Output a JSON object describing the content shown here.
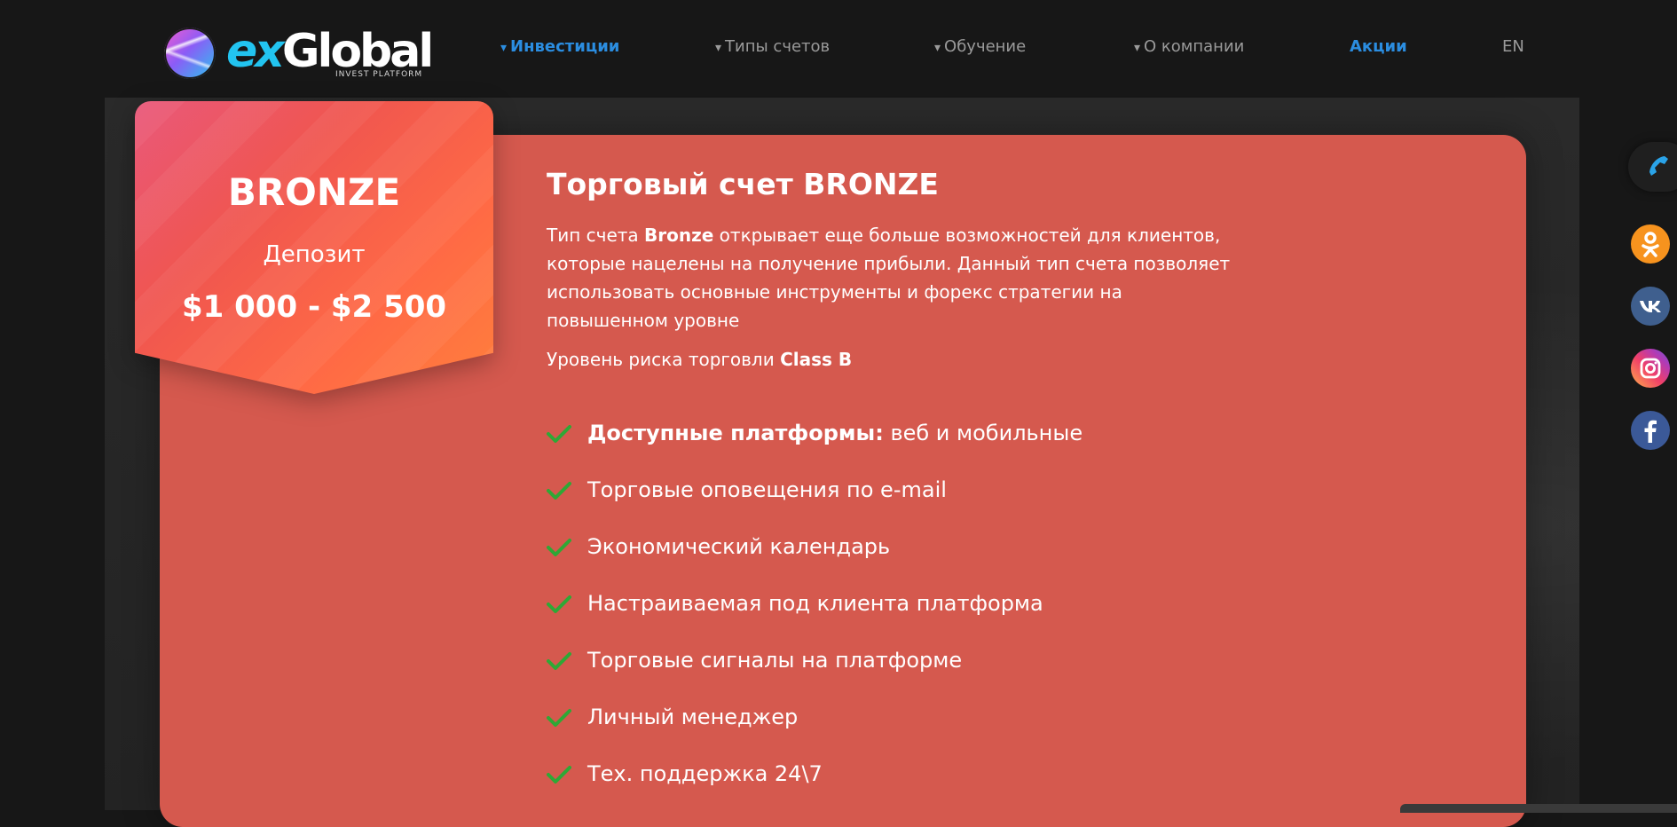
{
  "header": {
    "logo": {
      "ex": "ex",
      "global": "Global",
      "tagline": "INVEST PLATFORM"
    },
    "nav": [
      {
        "label": "Инвестиции",
        "caret": "▾",
        "active": true
      },
      {
        "label": "Типы счетов",
        "caret": "▾",
        "active": false
      },
      {
        "label": "Обучение",
        "caret": "▾",
        "active": false
      },
      {
        "label": "О компании",
        "caret": "▾",
        "active": false
      },
      {
        "label": "Акции",
        "active": true
      },
      {
        "label": "EN",
        "active": false
      }
    ]
  },
  "badge": {
    "title": "BRONZE",
    "deposit_label": "Депозит",
    "deposit_range": "$1 000 - $2 500"
  },
  "content": {
    "title": "Торговый счет BRONZE",
    "desc_prefix": "Тип счета ",
    "desc_bold": "Bronze",
    "desc_suffix": " открывает еще больше возможностей для клиентов, которые нацелены на получение прибыли. Данный тип счета позволяет использовать основные инструменты и форекс стратегии на повышенном уровне",
    "risk_prefix": "Уровень риска торговли ",
    "risk_bold": "Class B"
  },
  "features": [
    {
      "bold": "Доступные платформы:",
      "text": " веб и мобильные"
    },
    {
      "bold": "",
      "text": "Торговые оповещения по e-mail"
    },
    {
      "bold": "",
      "text": "Экономический календарь"
    },
    {
      "bold": "",
      "text": "Настраиваемая под клиента платформа"
    },
    {
      "bold": "",
      "text": "Торговые сигналы на платформе"
    },
    {
      "bold": "",
      "text": "Личный менеджер"
    },
    {
      "bold": "",
      "text": "Тех. поддержка 24\\7"
    }
  ],
  "social": [
    "phone-icon",
    "odnoklassniki-icon",
    "vk-icon",
    "instagram-icon",
    "facebook-icon"
  ],
  "colors": {
    "accent": "#2b8de0",
    "card": "#d5594e",
    "check": "#2fa836"
  }
}
